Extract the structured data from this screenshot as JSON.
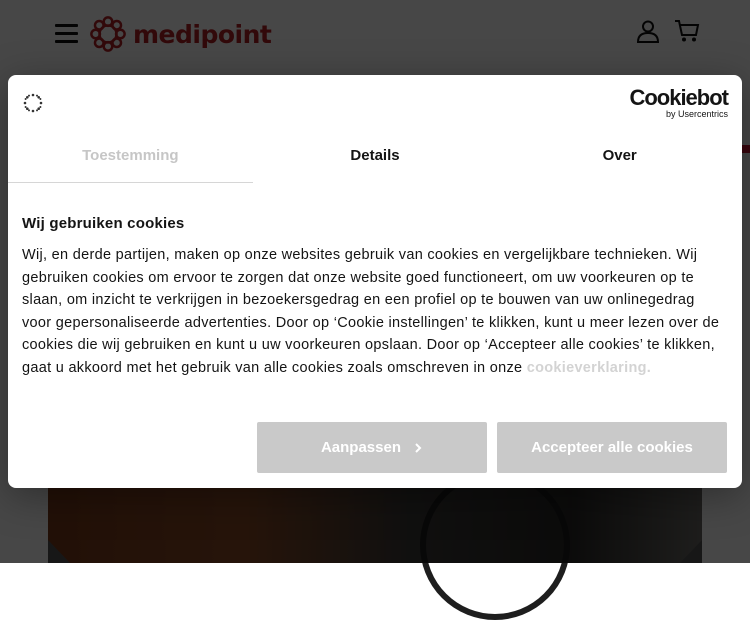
{
  "site": {
    "logo_text": "medipoint",
    "brand_color": "#b32025",
    "icons": [
      "menu-icon",
      "user-icon",
      "cart-icon"
    ]
  },
  "dialog": {
    "brand": {
      "name": "Cookiebot",
      "sub": "by Usercentrics"
    },
    "tabs": [
      {
        "label": "Toestemming",
        "active": true
      },
      {
        "label": "Details",
        "active": false
      },
      {
        "label": "Over",
        "active": false
      }
    ],
    "title": "Wij gebruiken cookies",
    "body": "Wij, en derde partijen, maken op onze websites gebruik van cookies en vergelijkbare technieken. Wij gebruiken cookies om ervoor te zorgen dat onze website goed functioneert, om uw voorkeuren op te slaan, om inzicht te verkrijgen in bezoekersgedrag en een profiel op te bouwen van uw onlinegedrag voor gepersonaliseerde advertenties. Door op ‘Cookie instellingen’ te klikken, kunt u meer lezen over de cookies die wij gebruiken en kunt u uw voorkeuren opslaan. Door op ‘Accepteer alle cookies’ te klikken, gaat u akkoord met het gebruik van alle cookies zoals omschreven in onze ",
    "link": "cookieverklaring.",
    "buttons": {
      "customize": "Aanpassen",
      "accept": "Accepteer alle cookies"
    }
  }
}
